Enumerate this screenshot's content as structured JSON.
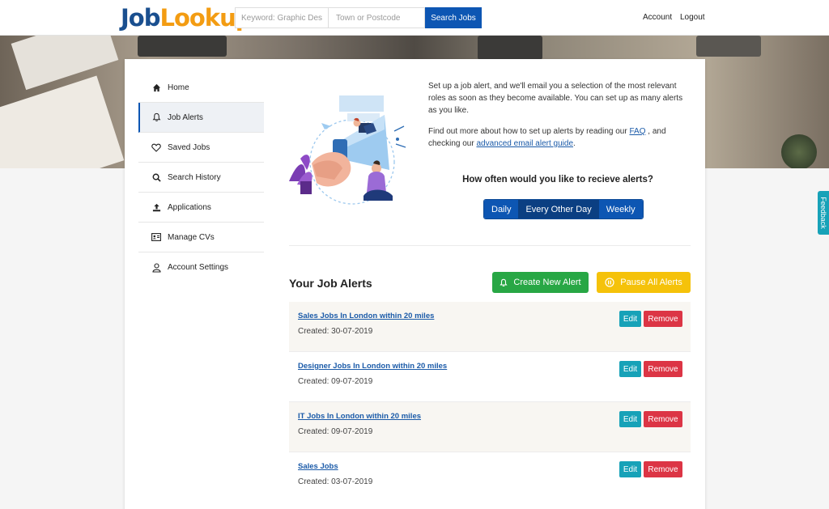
{
  "header": {
    "logo_part1": "Job",
    "logo_part2": "Lookup",
    "keyword_placeholder": "Keyword: Graphic Designer",
    "location_placeholder": "Town or Postcode",
    "search_label": "Search Jobs",
    "account_label": "Account",
    "logout_label": "Logout"
  },
  "sidebar": {
    "items": [
      {
        "label": "Home",
        "icon": "home-icon"
      },
      {
        "label": "Job Alerts",
        "icon": "bell-icon",
        "active": true
      },
      {
        "label": "Saved Jobs",
        "icon": "heart-icon"
      },
      {
        "label": "Search History",
        "icon": "search-icon"
      },
      {
        "label": "Applications",
        "icon": "upload-icon"
      },
      {
        "label": "Manage CVs",
        "icon": "id-card-icon"
      },
      {
        "label": "Account Settings",
        "icon": "user-icon"
      }
    ]
  },
  "intro": {
    "paragraph1": "Set up a job alert, and we'll email you a selection of the most relevant roles as soon as they become available. You can set up as many alerts as you like.",
    "paragraph2_before": "Find out more about how to set up alerts by reading our ",
    "faq_link": "FAQ",
    "paragraph2_middle": " , and checking our ",
    "guide_link": "advanced email alert guide",
    "paragraph2_after": "."
  },
  "frequency": {
    "question": "How often would you like to recieve alerts?",
    "options": [
      "Daily",
      "Every Other Day",
      "Weekly"
    ],
    "selected": "Every Other Day"
  },
  "alerts": {
    "title": "Your Job Alerts",
    "create_label": "Create New Alert",
    "pause_label": "Pause All Alerts",
    "edit_label": "Edit",
    "remove_label": "Remove",
    "items": [
      {
        "title": "Sales Jobs In London within 20 miles",
        "created": "Created: 30-07-2019"
      },
      {
        "title": "Designer Jobs In London within 20 miles",
        "created": "Created: 09-07-2019"
      },
      {
        "title": "IT Jobs In London within 20 miles",
        "created": "Created: 09-07-2019"
      },
      {
        "title": "Sales Jobs",
        "created": "Created: 03-07-2019"
      }
    ]
  },
  "feedback_label": "Feedback",
  "colors": {
    "primary": "#0d56b3",
    "accent_orange": "#f39c12",
    "create_green": "#28a745",
    "pause_yellow": "#f5c20a",
    "edit_teal": "#17a2b8",
    "remove_red": "#dc3545"
  }
}
